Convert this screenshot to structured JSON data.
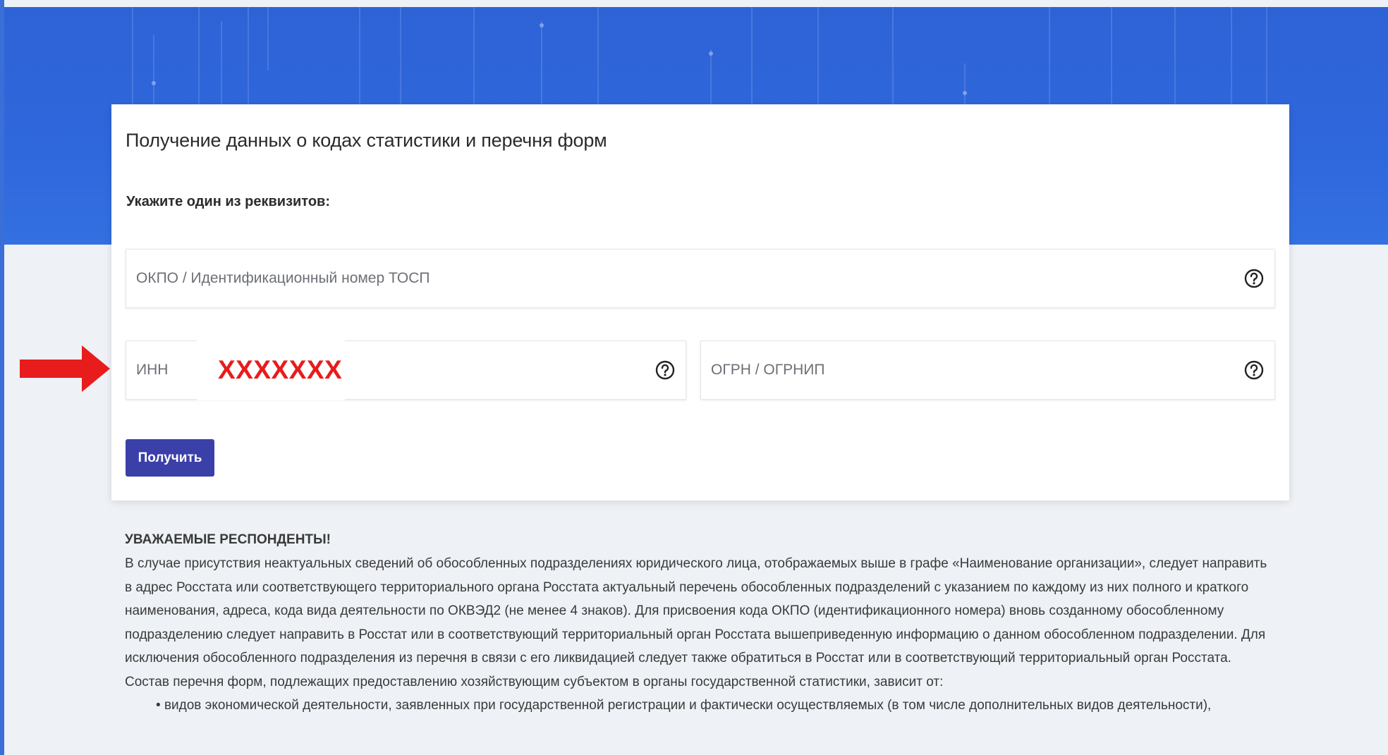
{
  "colors": {
    "hero_blue": "#2e63d6",
    "button_bg": "#3b40a8",
    "arrow_red": "#e81c1c",
    "page_bg": "#eef1f6"
  },
  "card": {
    "title": "Получение данных о кодах статистики и перечня форм",
    "subtitle": "Укажите один из реквизитов:",
    "fields": {
      "okpo": {
        "placeholder": "ОКПО / Идентификационный номер ТОСП",
        "help_icon": "question-circle-icon"
      },
      "inn": {
        "placeholder": "ИНН",
        "value": "XXXXXXX",
        "help_icon": "question-circle-icon"
      },
      "ogrn": {
        "placeholder": "ОГРН / ОГРНИП",
        "help_icon": "question-circle-icon"
      }
    },
    "submit_label": "Получить"
  },
  "annotation": {
    "arrow_icon": "red-arrow-right-icon"
  },
  "notice": {
    "heading": "УВАЖАЕМЫЕ РЕСПОНДЕНТЫ!",
    "paragraph_1": "В случае присутствия неактуальных сведений об обособленных подразделениях юридического лица, отображаемых выше в графе «Наименование организации», следует направить в адрес Росстата или соответствующего территориального органа Росстата актуальный перечень обособленных подразделений с указанием по каждому из них полного и краткого наименования, адреса, кода вида деятельности по ОКВЭД2 (не менее 4 знаков). Для присвоения кода ОКПО (идентификационного номера) вновь созданному обособленному подразделению следует направить в Росстат или в соответствующий территориальный орган Росстата вышеприведенную информацию о данном обособленном подразделении. Для исключения обособленного подразделения из перечня в связи с его ликвидацией следует также обратиться в Росстат или в соответствующий территориальный орган Росстата.",
    "paragraph_2": "Состав перечня форм, подлежащих предоставлению хозяйствующим субъектом в органы государственной статистики, зависит от:",
    "bullets": [
      "видов экономической деятельности, заявленных при государственной регистрации и фактически осуществляемых (в том числе дополнительных видов деятельности),"
    ]
  }
}
